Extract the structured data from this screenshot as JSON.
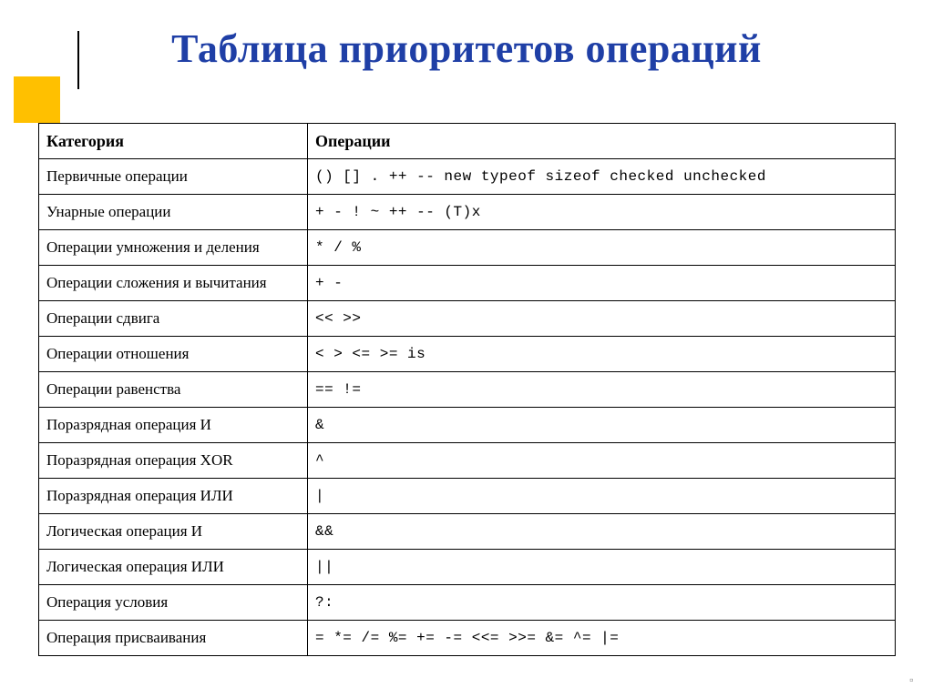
{
  "title": "Таблица приоритетов операций",
  "headers": {
    "category": "Категория",
    "operations": "Операции"
  },
  "rows": [
    {
      "category": "Первичные операции",
      "operations": "()  []  .  ++  --  new  typeof  sizeof  checked  unchecked"
    },
    {
      "category": "Унарные операции",
      "operations": "+  -  !  ~  ++  --  (T)x"
    },
    {
      "category": "Операции умножения и деления",
      "operations": "*  /  %"
    },
    {
      "category": "Операции сложения и вычитания",
      "operations": "+  -"
    },
    {
      "category": "Операции сдвига",
      "operations": "<<  >>"
    },
    {
      "category": "Операции отношения",
      "operations": "<  >  <=  >=  is"
    },
    {
      "category": "Операции равенства",
      "operations": "==  !="
    },
    {
      "category": "Поразрядная операция И",
      "operations": "&"
    },
    {
      "category": "Поразрядная операция XOR",
      "operations": "^"
    },
    {
      "category": "Поразрядная операция ИЛИ",
      "operations": "|"
    },
    {
      "category": "Логическая операция И",
      "operations": "&&"
    },
    {
      "category": "Логическая операция ИЛИ",
      "operations": "||"
    },
    {
      "category": "Операция условия",
      "operations": "?:"
    },
    {
      "category": "Операция присваивания",
      "operations": "=  *=  /=  %=  +=  -=  <<=  >>=  &=  ^=  |="
    }
  ],
  "end_mark": "▫"
}
